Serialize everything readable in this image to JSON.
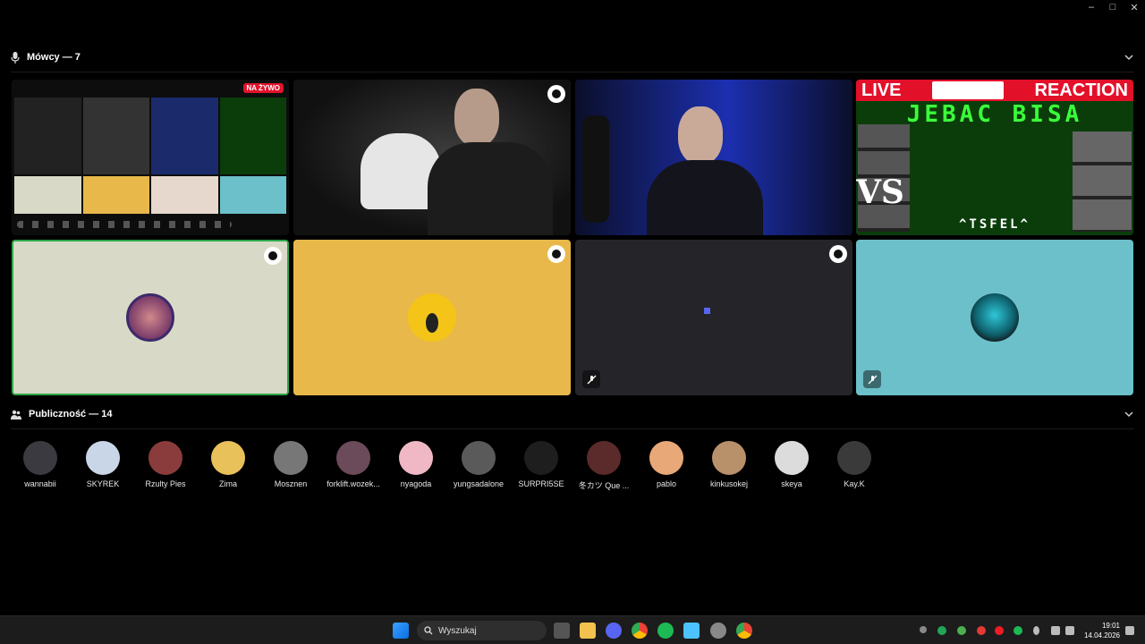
{
  "speakers": {
    "label": "Mówcy — 7"
  },
  "live_badge": "NA ŻYWO",
  "live_tile": {
    "left": "LIVE",
    "right": "REACTION",
    "headline": "JEBAC BISA",
    "footer": "^TSFEL^",
    "vs": "VS"
  },
  "tiles": [
    {
      "name": "screen-share-tile",
      "bg": "#0d0d0d"
    },
    {
      "name": "webcam-tile-1",
      "bg": "#1a1a1a"
    },
    {
      "name": "webcam-tile-2",
      "bg": "#1b2a6b"
    },
    {
      "name": "live-reaction-tile",
      "bg": "#0b3d0b"
    },
    {
      "name": "avatar-tile-1",
      "bg": "#d9d9c7",
      "avatar": "#b86b6b"
    },
    {
      "name": "avatar-tile-2",
      "bg": "#e8b84a",
      "avatar": "#f4c518"
    },
    {
      "name": "avatar-tile-3",
      "bg": "#252529",
      "avatar": "#5865f2"
    },
    {
      "name": "avatar-tile-4",
      "bg": "#6cc0c9",
      "avatar": "#222"
    }
  ],
  "audience": {
    "label": "Publiczność — 14",
    "members": [
      {
        "name": "wannabii",
        "color": "#3a3a40"
      },
      {
        "name": "SKYREK",
        "color": "#c9d6e8"
      },
      {
        "name": "Rzulty Pies",
        "color": "#8a3b3b"
      },
      {
        "name": "Zima",
        "color": "#e8c15a"
      },
      {
        "name": "Mosznen",
        "color": "#777"
      },
      {
        "name": "forklift.wozek...",
        "color": "#6b4a5a"
      },
      {
        "name": "nyagoda",
        "color": "#f0b8c4"
      },
      {
        "name": "yungsadalone",
        "color": "#5a5a5a"
      },
      {
        "name": "SURPRI5SE",
        "color": "#1e1e1e"
      },
      {
        "name": "冬カツ Que ...",
        "color": "#5b2a2a"
      },
      {
        "name": "pablo",
        "color": "#e8a878"
      },
      {
        "name": "kinkusokej",
        "color": "#b8906a"
      },
      {
        "name": "skeya",
        "color": "#dcdcdc"
      },
      {
        "name": "Kay.K",
        "color": "#3a3a3a"
      }
    ]
  },
  "taskbar": {
    "search_placeholder": "Wyszukaj",
    "time": "19:01",
    "date": "14.04.2026"
  }
}
